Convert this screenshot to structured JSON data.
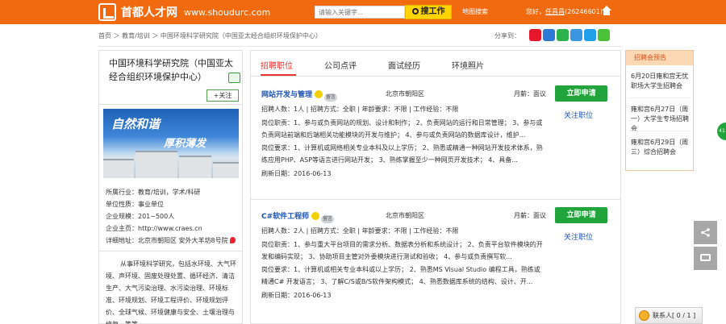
{
  "header": {
    "logo_name": "首都人才网",
    "logo_domain": "www.shoudurc.com",
    "search_placeholder": "请输入关键字...",
    "search_button": "搜工作",
    "map_search": "地图搜索",
    "welcome_prefix": "您好，",
    "user_name": "任昌昌",
    "user_id": "(26246601)"
  },
  "breadcrumb": "首页 ＞ 教育/培训 ＞ 中国环境科学研究院（中国亚太经合组织环境保护中心）",
  "share_label": "分享到：",
  "colors": {
    "brand_orange": "#f26a10",
    "apply_green": "#21a43b",
    "link_blue": "#1f55b5",
    "active_red": "#e33333"
  },
  "company": {
    "name": "中国环境科学研究院（中国亚太经合组织环境保护中心）",
    "follow_label": "+关注",
    "photo_text_1": "自然和谐",
    "photo_text_2": "厚积薄发",
    "industry": "所属行业：教育/培训，学术/科研",
    "nature": "单位性质：事业单位",
    "size": "企业规模：201~500人",
    "homepage": "企业主页：http://www.craes.cn",
    "address": "详细地址：北京市朝阳区 安外大羊坊8号院",
    "description": "从事环境科学研究，包括水环境、大气环境、声环境、固废处理处置、循环经济、清洁生产、大气污染治理、水污染治理、环境标准、环境规划、环境工程评价、环境规划评价、全球气候、环境健康与安全、土壤治理与修复，等等"
  },
  "tabs": [
    {
      "label": "招聘职位"
    },
    {
      "label": "公司点评"
    },
    {
      "label": "面试经历"
    },
    {
      "label": "环境照片"
    }
  ],
  "jobs": [
    {
      "title": "网站开发与管理",
      "msg_badge": "留言",
      "location": "北京市朝阳区",
      "salary": "月薪：面议",
      "apply": "立即申请",
      "follow": "关注职位",
      "meta": "招聘人数：1人  |  招聘方式：全职  |  年龄要求：不限  |  工作经验：不限",
      "duty": "岗位职责：1、参与或负责网站的规划、设计和制作； 2、负责网站的运行和日常管理； 3、参与或负责网站前端和后端相关功能模块的开发与维护； 4、参与或负责网站的数据库设计，维护...",
      "req": "岗位要求：1、计算机或网络相关专业本科及以上学历； 2、熟悉或精通一种网站开发技术体系，熟练应用PHP、ASP等语言进行网站开发； 3、熟练掌握至少一种网页开发技术； 4、具备...",
      "refresh": "刷新日期：2016-06-13"
    },
    {
      "title": "C#软件工程师",
      "msg_badge": "留言",
      "location": "北京市朝阳区",
      "salary": "月薪：面议",
      "apply": "立即申请",
      "follow": "关注职位",
      "meta": "招聘人数：2人  |  招聘方式：全职  |  年龄要求：不限  |  工作经验：不限",
      "duty": "岗位职责：1、参与重大平台项目的需求分析、数据表分析和系统设计； 2、负责平台软件模块的开发和编码实现； 3、协助项目主管对外委模块进行测试和验收； 4、参与或负责撰写软...",
      "req": "岗位要求：1、计算机或相关专业本科或以上学历； 2、熟悉MS Visual Studio 编程工具，熟练或精通C# 开发语言； 3、了解C/S或B/S软件架构模式； 4、熟悉数据库系统的结构、设计、开...",
      "refresh": "刷新日期：2016-06-13"
    }
  ],
  "job_fairs": {
    "title": "招聘会预告",
    "items": [
      "6月20日雍和宫无忧职场大学生招聘会",
      "雍和宫6月27日（周一）大学生专场招聘会",
      "雍和宫6月29日（周三）综合招聘会"
    ]
  },
  "float": {
    "side_tab": "41",
    "contacts": "联系人[ 0 / 1 ]"
  }
}
